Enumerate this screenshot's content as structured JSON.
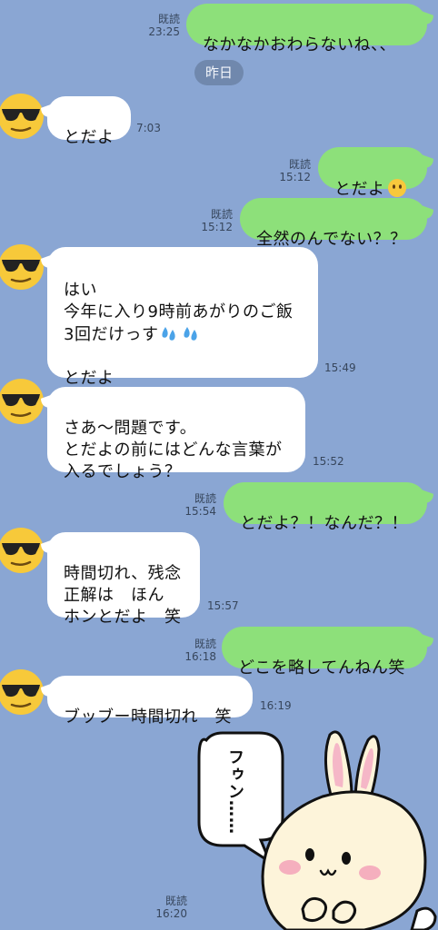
{
  "messages": [
    {
      "side": "out",
      "text": "なかなかおわらないね、、",
      "read": "既読",
      "time": "23:25"
    },
    {
      "side": "date",
      "text": "昨日"
    },
    {
      "side": "in",
      "text": "とだよ",
      "time": "7:03"
    },
    {
      "side": "out",
      "text": "とだよ",
      "read": "既読",
      "time": "15:12",
      "emoji": "no-mouth-face-icon"
    },
    {
      "side": "out",
      "text": "全然のんでない？？",
      "read": "既読",
      "time": "15:12"
    },
    {
      "side": "in",
      "text": "はい\n今年に入り9時前あがりのご飯\n3回だけっす",
      "text2": "とだよ",
      "time": "15:49",
      "emoji": "sweat-droplets-icon"
    },
    {
      "side": "in",
      "text": "さあ〜問題です。\nとだよの前にはどんな言葉が\n入るでしょう？",
      "time": "15:52"
    },
    {
      "side": "out",
      "text": "とだよ？！なんだ？！",
      "read": "既読",
      "time": "15:54"
    },
    {
      "side": "in",
      "text": "時間切れ、残念\n正解は　ほん\nホンとだよ　笑",
      "time": "15:57"
    },
    {
      "side": "out",
      "text": "どこを略してんねん笑",
      "read": "既読",
      "time": "16:18"
    },
    {
      "side": "in",
      "text": "ブッブー時間切れ　笑",
      "time": "16:19"
    },
    {
      "side": "sticker",
      "read": "既読",
      "time": "16:20",
      "sticker_text": "フゥン……",
      "sticker": "rabbit-sticker"
    }
  ],
  "avatar_icon": "sunglasses-face-icon",
  "colors": {
    "background": "#8aa6d3",
    "outgoing_bubble": "#8de07a",
    "incoming_bubble": "#ffffff",
    "date_pill": "#7088ad"
  }
}
